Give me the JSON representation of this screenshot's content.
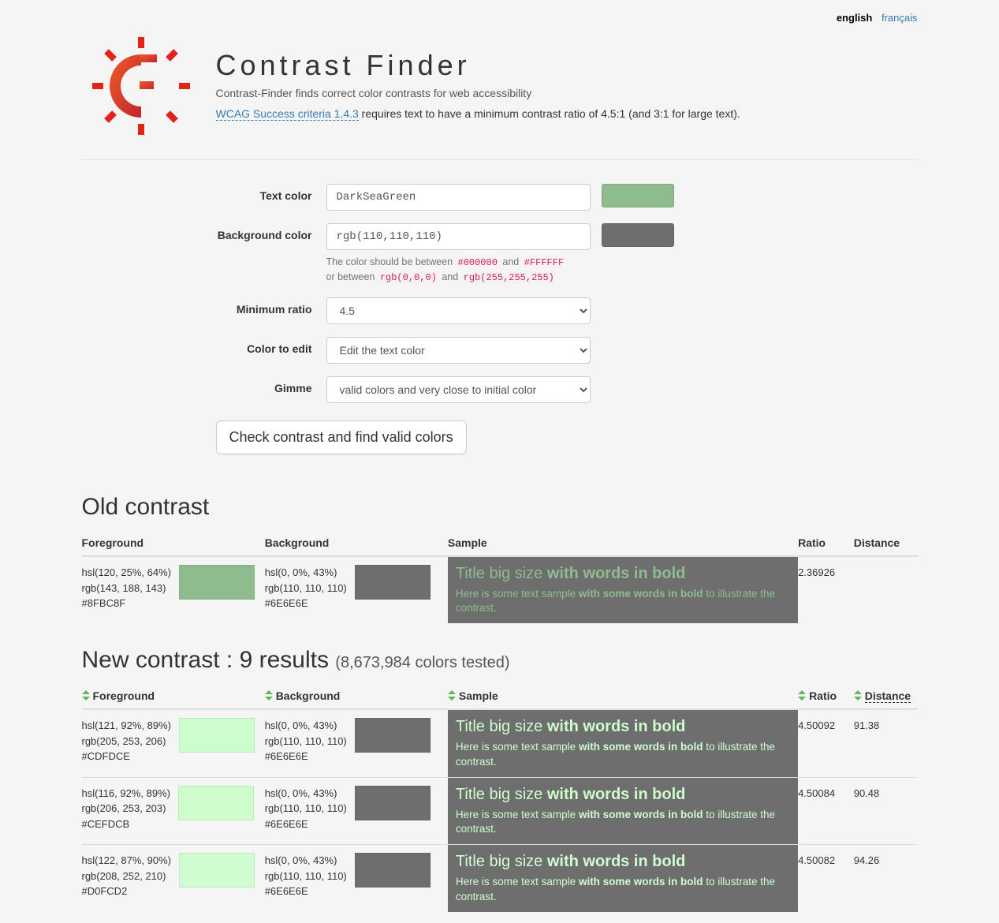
{
  "lang": {
    "current": "english",
    "other": "français"
  },
  "header": {
    "title": "Contrast Finder",
    "tagline": "Contrast-Finder finds correct color contrasts for web accessibility",
    "wcag_link": "WCAG Success criteria 1.4.3",
    "wcag_rest": " requires text to have a minimum contrast ratio of 4.5:1 (and 3:1 for large text)."
  },
  "form": {
    "text_color_label": "Text color",
    "text_color_value": "DarkSeaGreen",
    "text_color_swatch": "#8FBC8F",
    "bg_color_label": "Background color",
    "bg_color_value": "rgb(110,110,110)",
    "bg_color_swatch": "#6E6E6E",
    "help_line1_a": "The color should be between ",
    "help_code1": "#000000",
    "help_line1_b": " and ",
    "help_code2": "#FFFFFF",
    "help_line2_a": "or between ",
    "help_code3": "rgb(0,0,0)",
    "help_line2_b": " and ",
    "help_code4": "rgb(255,255,255)",
    "ratio_label": "Minimum ratio",
    "ratio_value": "4.5",
    "edit_label": "Color to edit",
    "edit_value": "Edit the text color",
    "gimme_label": "Gimme",
    "gimme_value": "valid colors and very close to initial color",
    "submit": "Check contrast and find valid colors"
  },
  "old": {
    "heading": "Old contrast",
    "cols": {
      "fg": "Foreground",
      "bg": "Background",
      "sample": "Sample",
      "ratio": "Ratio",
      "dist": "Distance"
    },
    "row": {
      "fg": {
        "hsl": "hsl(120, 25%, 64%)",
        "rgb": "rgb(143, 188, 143)",
        "hex": "#8FBC8F",
        "swatch": "#8FBC8F"
      },
      "bg": {
        "hsl": "hsl(0, 0%, 43%)",
        "rgb": "rgb(110, 110, 110)",
        "hex": "#6E6E6E",
        "swatch": "#6E6E6E"
      },
      "ratio": "2.36926",
      "dist": ""
    }
  },
  "new": {
    "heading_a": "New contrast : 9 results ",
    "heading_b": "(8,673,984 colors tested)",
    "cols": {
      "fg": "Foreground",
      "bg": "Background",
      "sample": "Sample",
      "ratio": "Ratio",
      "dist": "Distance"
    },
    "rows": [
      {
        "fg": {
          "hsl": "hsl(121, 92%, 89%)",
          "rgb": "rgb(205, 253, 206)",
          "hex": "#CDFDCE",
          "swatch": "#CDFDCE"
        },
        "bg": {
          "hsl": "hsl(0, 0%, 43%)",
          "rgb": "rgb(110, 110, 110)",
          "hex": "#6E6E6E",
          "swatch": "#6E6E6E"
        },
        "ratio": "4.50092",
        "dist": "91.38"
      },
      {
        "fg": {
          "hsl": "hsl(116, 92%, 89%)",
          "rgb": "rgb(206, 253, 203)",
          "hex": "#CEFDCB",
          "swatch": "#CEFDCB"
        },
        "bg": {
          "hsl": "hsl(0, 0%, 43%)",
          "rgb": "rgb(110, 110, 110)",
          "hex": "#6E6E6E",
          "swatch": "#6E6E6E"
        },
        "ratio": "4.50084",
        "dist": "90.48"
      },
      {
        "fg": {
          "hsl": "hsl(122, 87%, 90%)",
          "rgb": "rgb(208, 252, 210)",
          "hex": "#D0FCD2",
          "swatch": "#D0FCD2"
        },
        "bg": {
          "hsl": "hsl(0, 0%, 43%)",
          "rgb": "rgb(110, 110, 110)",
          "hex": "#6E6E6E",
          "swatch": "#6E6E6E"
        },
        "ratio": "4.50082",
        "dist": "94.26"
      }
    ]
  },
  "sample": {
    "title_a": "Title big size ",
    "title_b": "with words in bold",
    "text_a": "Here is some text sample ",
    "text_b": "with some words in bold",
    "text_c": " to illustrate the contrast."
  }
}
